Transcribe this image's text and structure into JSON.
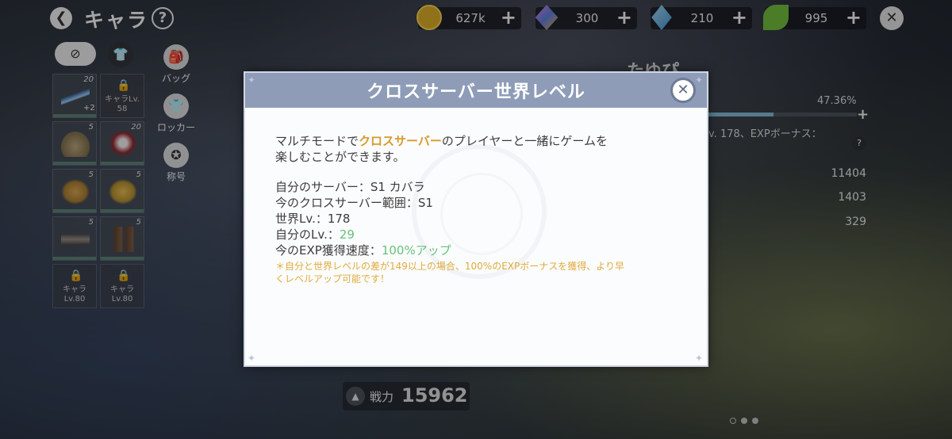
{
  "header": {
    "title": "キャラ",
    "help": "?",
    "back_icon": "back-arrow-icon",
    "close": "✕"
  },
  "resources": [
    {
      "name": "gold",
      "value": "627k",
      "color": "#d4a928"
    },
    {
      "name": "crystal",
      "value": "300",
      "color": "#c55ab8"
    },
    {
      "name": "gem",
      "value": "210",
      "color": "#3f8fc4"
    },
    {
      "name": "leaf",
      "value": "995",
      "color": "#6fb83b"
    }
  ],
  "equipment": {
    "slots": [
      {
        "level": "20",
        "extra": "+2",
        "color": "#4a78b0"
      },
      {
        "locked": true,
        "label": "キャラLv.",
        "label2": "58"
      },
      {
        "level": "5",
        "color": "#8a7a5a"
      },
      {
        "level": "20",
        "color": "#8a2a30"
      },
      {
        "level": "5",
        "color": "#a87a30"
      },
      {
        "level": "5",
        "color": "#b08a30"
      },
      {
        "level": "5",
        "color": "#6a5a50"
      },
      {
        "level": "5",
        "color": "#5a4030"
      },
      {
        "locked": true,
        "label": "キャラ",
        "label2": "Lv.80"
      },
      {
        "locked": true,
        "label": "キャラ",
        "label2": "Lv.80"
      }
    ]
  },
  "side_menu": [
    {
      "label": "バッグ",
      "icon": "bag-icon"
    },
    {
      "label": "ロッカー",
      "icon": "locker-icon"
    },
    {
      "label": "称号",
      "icon": "title-icon"
    }
  ],
  "character": {
    "name": "たゆぴ",
    "exp_percent": "47.36%",
    "exp_fraction": 0.4736,
    "exp_text": "v. 178、EXPボーナス：",
    "stats": [
      "11404",
      "1403",
      "329"
    ],
    "power_label": "戦力",
    "power_value": "15962"
  },
  "modal": {
    "title": "クロスサーバー世界レベル",
    "line1_pre": "マルチモードで",
    "line1_hl": "クロスサーバー",
    "line1_post": "のプレイヤーと一緒にゲームを",
    "line2": "楽しむことができます。",
    "info": {
      "server": "自分のサーバー：S1 カバラ",
      "range": "今のクロスサーバー範囲：S1",
      "world_lv": "世界Lv.：178",
      "my_lv_label": "自分のLv.：",
      "my_lv": "29",
      "speed_label": "今のEXP獲得速度：",
      "speed": "100%アップ"
    },
    "note1": "＊自分と世界レベルの差が149以上の場合、100%のEXPボーナスを獲得、より早",
    "note2": "くレベルアップ可能です！"
  }
}
